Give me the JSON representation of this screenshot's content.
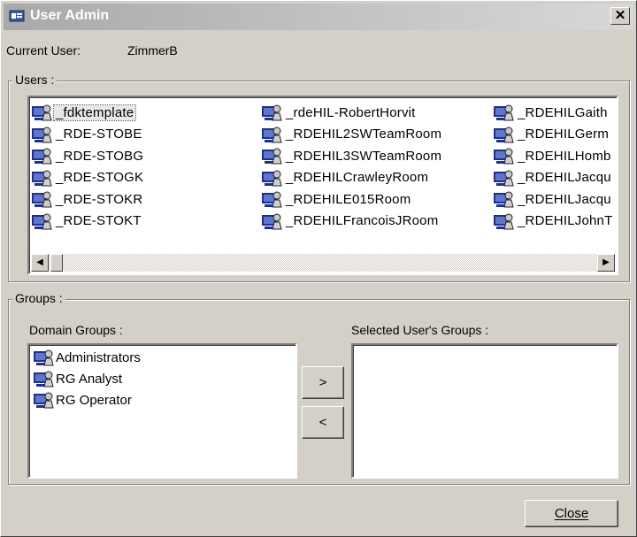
{
  "window": {
    "title": "User Admin",
    "close_glyph": "✕"
  },
  "current_user": {
    "label": "Current User:",
    "value": "ZimmerB"
  },
  "users": {
    "label": "Users :",
    "items": [
      {
        "name": "_fdktemplate",
        "selected": true
      },
      {
        "name": "_RDE-STOBE"
      },
      {
        "name": "_RDE-STOBG"
      },
      {
        "name": "_RDE-STOGK"
      },
      {
        "name": "_RDE-STOKR"
      },
      {
        "name": "_RDE-STOKT"
      },
      {
        "name": "_rdeHIL-RobertHorvit"
      },
      {
        "name": "_RDEHIL2SWTeamRoom"
      },
      {
        "name": "_RDEHIL3SWTeamRoom"
      },
      {
        "name": "_RDEHILCrawleyRoom"
      },
      {
        "name": "_RDEHILE015Room"
      },
      {
        "name": "_RDEHILFrancoisJRoom"
      },
      {
        "name": "_RDEHILGaith"
      },
      {
        "name": "_RDEHILGerm"
      },
      {
        "name": "_RDEHILHomb"
      },
      {
        "name": "_RDEHILJacqu"
      },
      {
        "name": "_RDEHILJacqu"
      },
      {
        "name": "_RDEHILJohnT"
      }
    ],
    "scroll_left_glyph": "◀",
    "scroll_right_glyph": "▶"
  },
  "groups": {
    "label": "Groups :",
    "domain_label": "Domain Groups :",
    "selected_label": "Selected User's Groups :",
    "domain_groups": [
      "Administrators",
      "RG Analyst",
      "RG Operator"
    ],
    "selected_groups": [],
    "add_label": ">",
    "remove_label": "<"
  },
  "buttons": {
    "close": "Close"
  },
  "colors": {
    "title_gradient_start": "#a9a9a9",
    "face": "#d4d0c8",
    "icon_blue": "#1f2f8f"
  }
}
